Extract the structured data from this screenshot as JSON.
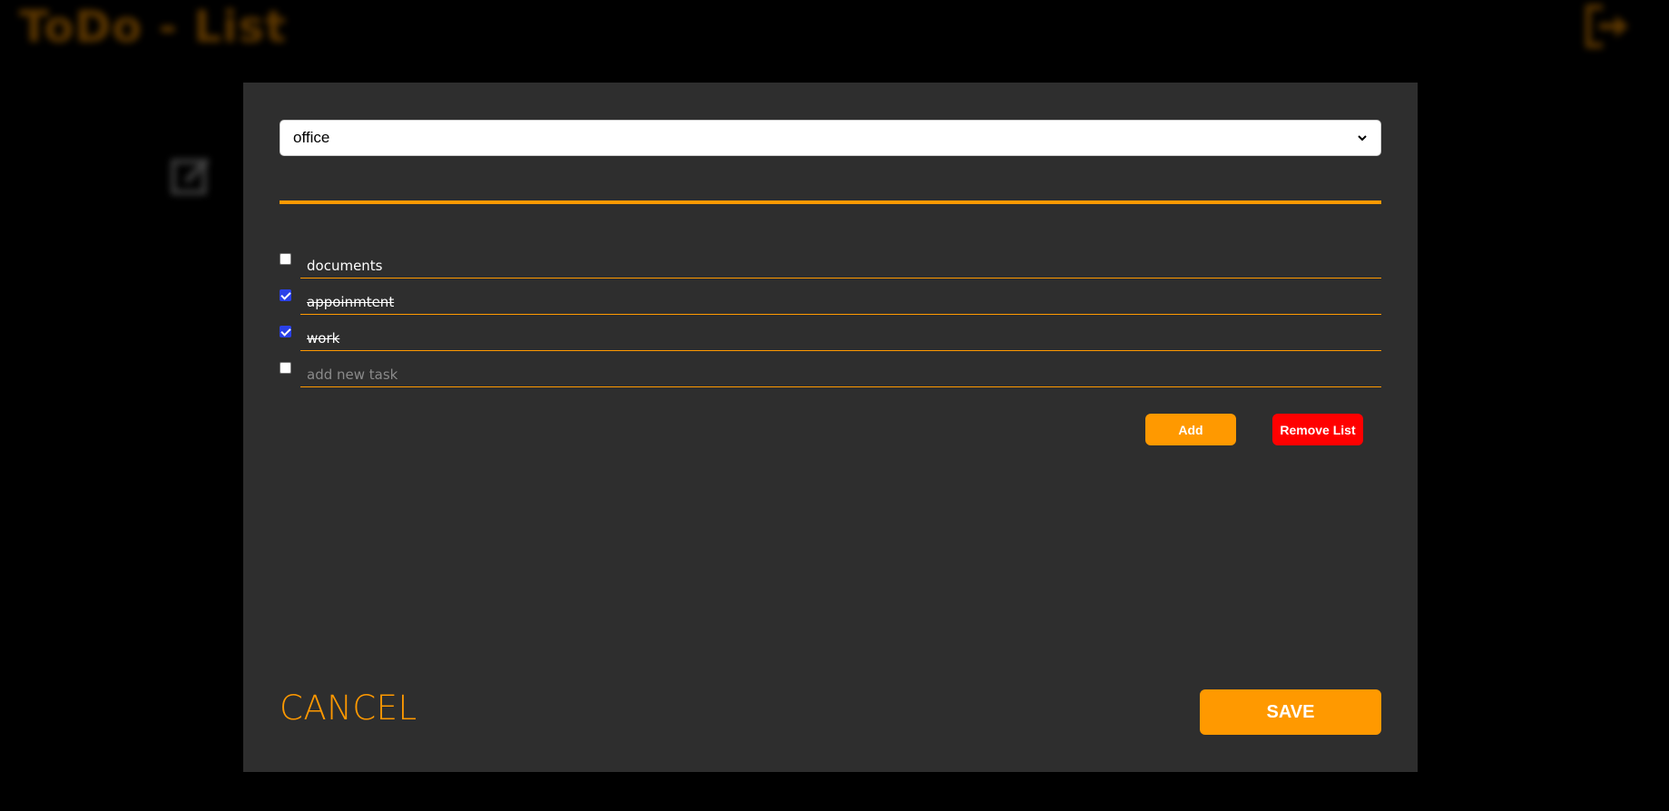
{
  "app": {
    "title": "ToDo - List"
  },
  "list_select": {
    "value": "office"
  },
  "tasks": [
    {
      "label": "documents",
      "checked": false
    },
    {
      "label": "appoinmtent",
      "checked": true
    },
    {
      "label": "work",
      "checked": true
    }
  ],
  "new_task": {
    "placeholder": "add new task"
  },
  "actions": {
    "add_label": "Add",
    "remove_label": "Remove List",
    "cancel_label": "CANCEL",
    "save_label": "SAVE"
  },
  "colors": {
    "accent": "#ff9900",
    "danger": "#ff0000",
    "modal_bg": "#2e2e2e",
    "page_bg": "#000000"
  },
  "icons": {
    "logout": "logout-icon",
    "edit": "edit-note-icon",
    "dropdown": "chevron-down-icon"
  }
}
